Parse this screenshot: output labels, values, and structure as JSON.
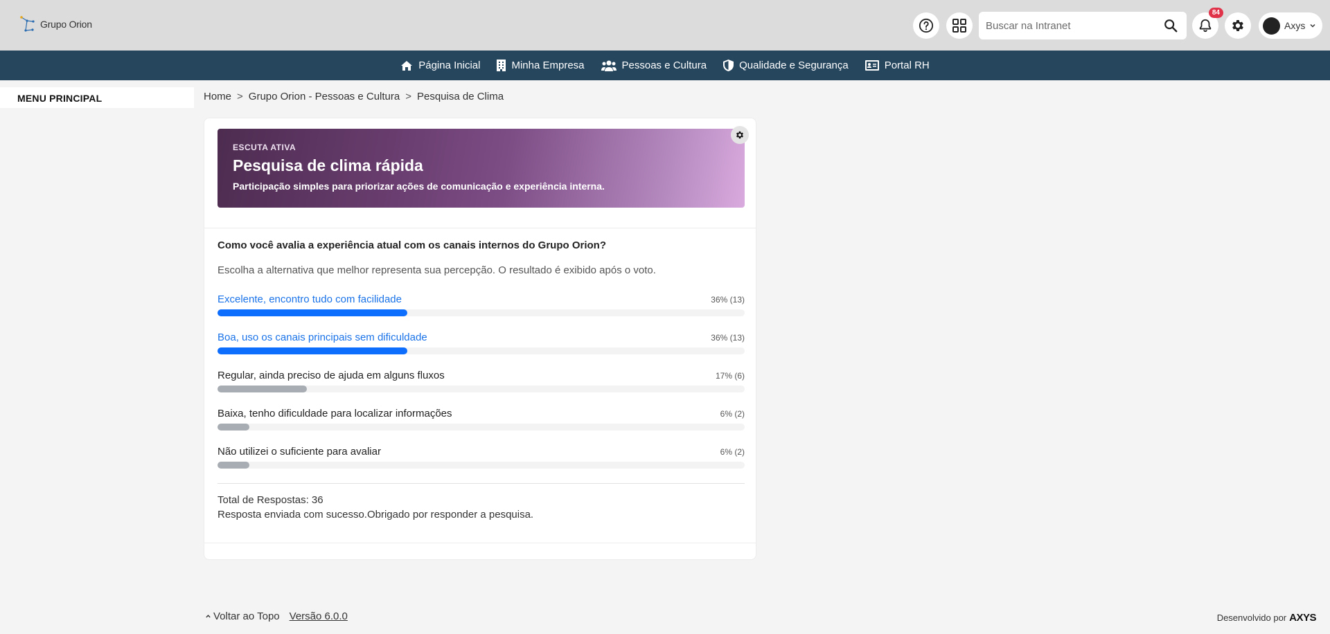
{
  "header": {
    "logo_text": "Grupo Orion",
    "search_placeholder": "Buscar na Intranet",
    "notification_count": "84",
    "user_name": "Axys"
  },
  "nav": {
    "items": [
      {
        "label": "Página Inicial",
        "icon": "home-icon"
      },
      {
        "label": "Minha Empresa",
        "icon": "building-icon"
      },
      {
        "label": "Pessoas e Cultura",
        "icon": "users-icon"
      },
      {
        "label": "Qualidade e Segurança",
        "icon": "shield-icon"
      },
      {
        "label": "Portal RH",
        "icon": "id-card-icon"
      }
    ]
  },
  "sidebar": {
    "title": "MENU PRINCIPAL"
  },
  "breadcrumb": [
    "Home",
    "Grupo Orion - Pessoas e Cultura",
    "Pesquisa de Clima"
  ],
  "hero": {
    "kicker": "ESCUTA ATIVA",
    "title": "Pesquisa de clima rápida",
    "subtitle": "Participação simples para priorizar ações de comunicação e experiência interna."
  },
  "poll": {
    "question": "Como você avalia a experiência atual com os canais internos do Grupo Orion?",
    "hint": "Escolha a alternativa que melhor representa sua percepção. O resultado é exibido após o voto.",
    "options": [
      {
        "label": "Excelente, encontro tudo com facilidade",
        "result": "36% (13)",
        "percent": 36,
        "selected": true
      },
      {
        "label": "Boa, uso os canais principais sem dificuldade",
        "result": "36% (13)",
        "percent": 36,
        "selected": true
      },
      {
        "label": "Regular, ainda preciso de ajuda em alguns fluxos",
        "result": "17% (6)",
        "percent": 17,
        "selected": false
      },
      {
        "label": "Baixa, tenho dificuldade para localizar informações",
        "result": "6% (2)",
        "percent": 6,
        "selected": false
      },
      {
        "label": "Não utilizei o suficiente para avaliar",
        "result": "6% (2)",
        "percent": 6,
        "selected": false
      }
    ],
    "total": "Total de Respostas: 36",
    "success": "Resposta enviada com sucesso.Obrigado por responder a pesquisa."
  },
  "footer": {
    "back_to_top": "Voltar ao Topo",
    "version": "Versão 6.0.0",
    "developed_by": "Desenvolvido por",
    "brand": "AXYS"
  },
  "colors": {
    "nav_bg": "#26465e",
    "selected": "#0d6efd",
    "unselected_bar": "#a8adb3",
    "badge": "#e0334a"
  }
}
